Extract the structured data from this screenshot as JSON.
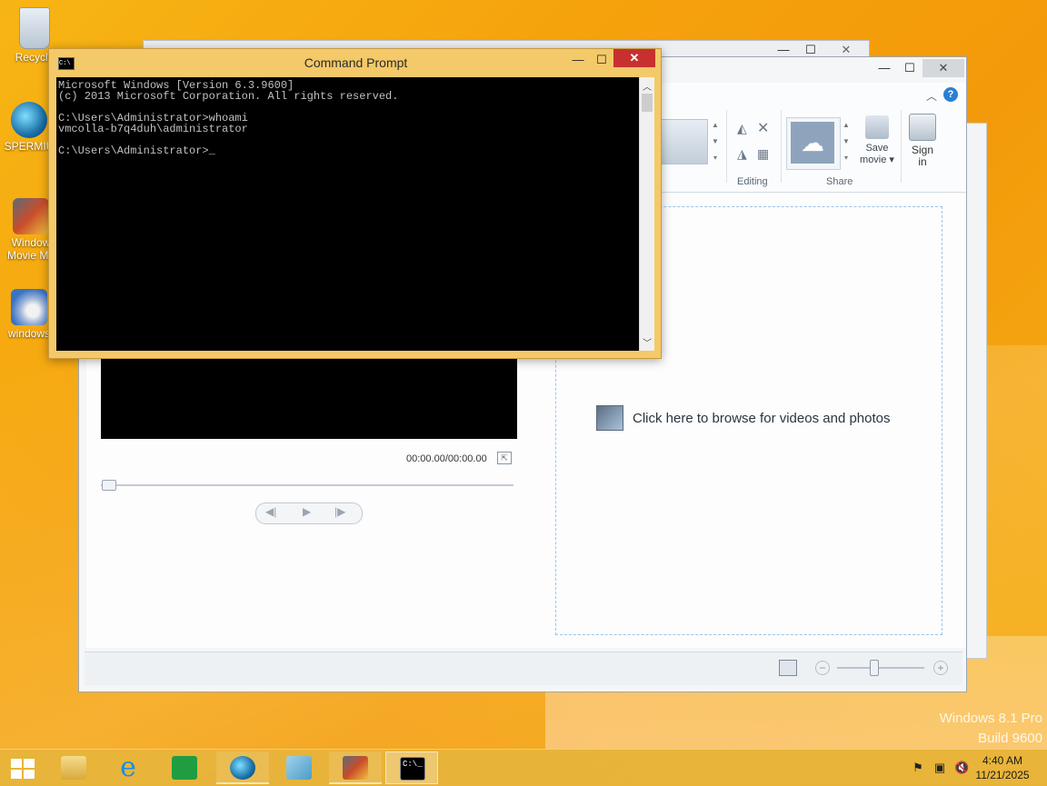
{
  "desktop": {
    "icons": [
      {
        "label": "Recycle",
        "icon": "recycle-bin-icon"
      },
      {
        "label": "SPERMIU",
        "icon": "spermiu-app-icon"
      },
      {
        "label": "Window",
        "label2": "Movie Ma",
        "icon": "movie-maker-icon"
      },
      {
        "label": "windows",
        "icon": "windows-dvd-icon"
      }
    ],
    "watermark": {
      "line1": "Windows 8.1 Pro",
      "line2": "Build 9600"
    }
  },
  "cmd": {
    "title": "Command Prompt",
    "minimize": "—",
    "maximize": "☐",
    "close": "✕",
    "lines": [
      "Microsoft Windows [Version 6.3.9600]",
      "(c) 2013 Microsoft Corporation. All rights reserved.",
      "",
      "C:\\Users\\Administrator>whoami",
      "vmcolla-b7q4duh\\administrator",
      "",
      "C:\\Users\\Administrator>_"
    ]
  },
  "moviemaker": {
    "ribbon": {
      "editing_label": "Editing",
      "share_label": "Share",
      "save_movie": "Save",
      "save_movie2": "movie",
      "sign_in": "Sign",
      "sign_in2": "in"
    },
    "time_display": "00:00.00/00:00.00",
    "browse_prompt": "Click here to browse for videos and photos",
    "help": "?"
  },
  "taskbar": {
    "time": "4:40 AM",
    "date": "11/21/2025",
    "apps": [
      {
        "name": "start"
      },
      {
        "name": "file-explorer"
      },
      {
        "name": "internet-explorer"
      },
      {
        "name": "store"
      },
      {
        "name": "spermiu"
      },
      {
        "name": "notepad"
      },
      {
        "name": "movie-maker"
      },
      {
        "name": "command-prompt"
      }
    ]
  },
  "colors": {
    "desktop": "#f5a60f",
    "cmd_frame": "#f3c969",
    "close_red": "#c7302f"
  }
}
